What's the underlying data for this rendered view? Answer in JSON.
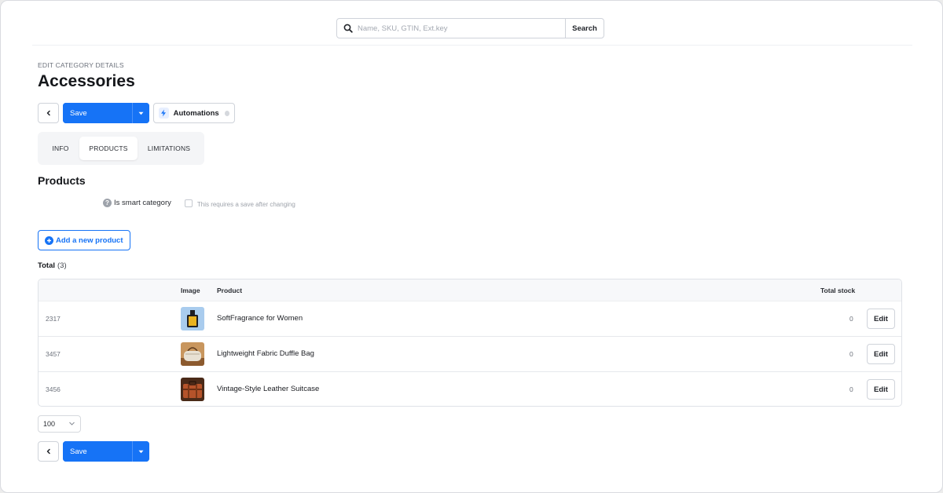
{
  "header": {
    "search_placeholder": "Name, SKU, GTIN, Ext.key",
    "search_button": "Search"
  },
  "page": {
    "eyebrow": "EDIT CATEGORY DETAILS",
    "title": "Accessories"
  },
  "toolbar": {
    "save_label": "Save",
    "automations_label": "Automations"
  },
  "tabs": [
    {
      "label": "INFO",
      "active": false
    },
    {
      "label": "PRODUCTS",
      "active": true
    },
    {
      "label": "LIMITATIONS",
      "active": false
    }
  ],
  "products": {
    "section_title": "Products",
    "smart_label": "Is smart category",
    "smart_hint": "This requires a save after changing",
    "add_button": "Add a new product",
    "total_label": "Total",
    "total_count": "(3)",
    "columns": {
      "image": "Image",
      "product": "Product",
      "stock": "Total stock"
    },
    "rows": [
      {
        "id": "2317",
        "name": "SoftFragrance for Women",
        "stock": "0",
        "edit": "Edit",
        "thumb": "perfume"
      },
      {
        "id": "3457",
        "name": "Lightweight Fabric Duffle Bag",
        "stock": "0",
        "edit": "Edit",
        "thumb": "duffle-bag"
      },
      {
        "id": "3456",
        "name": "Vintage-Style Leather Suitcase",
        "stock": "0",
        "edit": "Edit",
        "thumb": "suitcase"
      }
    ],
    "per_page": "100"
  },
  "colors": {
    "accent": "#1673f6",
    "border": "#cfd3da",
    "muted_text": "#6d727c"
  }
}
